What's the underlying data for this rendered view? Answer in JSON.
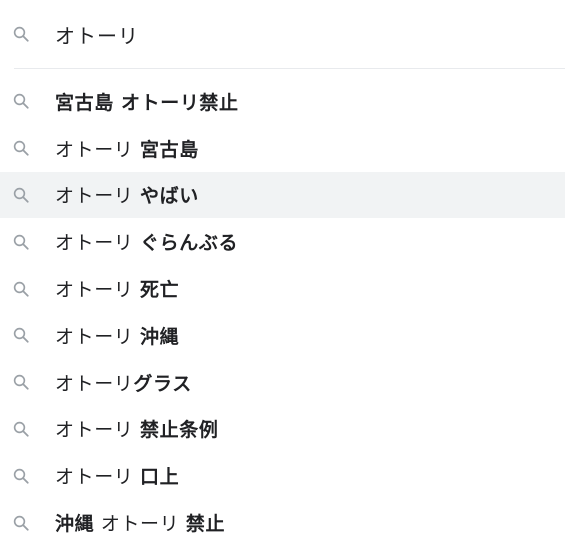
{
  "search": {
    "query": "オトーリ"
  },
  "suggestions": [
    {
      "parts": [
        {
          "text": "宮古島 オトーリ禁止",
          "bold": true
        }
      ]
    },
    {
      "parts": [
        {
          "text": "オトーリ ",
          "bold": false
        },
        {
          "text": "宮古島",
          "bold": true
        }
      ]
    },
    {
      "parts": [
        {
          "text": "オトーリ ",
          "bold": false
        },
        {
          "text": "やばい",
          "bold": true
        }
      ],
      "highlighted": true
    },
    {
      "parts": [
        {
          "text": "オトーリ ",
          "bold": false
        },
        {
          "text": "ぐらんぶる",
          "bold": true
        }
      ]
    },
    {
      "parts": [
        {
          "text": "オトーリ ",
          "bold": false
        },
        {
          "text": "死亡",
          "bold": true
        }
      ]
    },
    {
      "parts": [
        {
          "text": "オトーリ ",
          "bold": false
        },
        {
          "text": "沖縄",
          "bold": true
        }
      ]
    },
    {
      "parts": [
        {
          "text": "オトーリ",
          "bold": false
        },
        {
          "text": "グラス",
          "bold": true
        }
      ]
    },
    {
      "parts": [
        {
          "text": "オトーリ ",
          "bold": false
        },
        {
          "text": "禁止条例",
          "bold": true
        }
      ]
    },
    {
      "parts": [
        {
          "text": "オトーリ ",
          "bold": false
        },
        {
          "text": "口上",
          "bold": true
        }
      ]
    },
    {
      "parts": [
        {
          "text": "沖縄",
          "bold": true
        },
        {
          "text": " オトーリ ",
          "bold": false
        },
        {
          "text": "禁止",
          "bold": true
        }
      ]
    }
  ],
  "icons": {
    "search": "search-icon"
  },
  "colors": {
    "icon": "#9aa0a6",
    "text": "#202124",
    "highlight": "#f1f3f4",
    "divider": "#e8eaed"
  }
}
